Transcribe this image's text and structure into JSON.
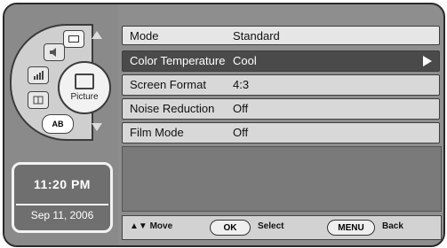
{
  "menu": {
    "header": {
      "label": "Mode",
      "value": "Standard"
    },
    "items": [
      {
        "label": "Color Temperature",
        "value": "Cool",
        "selected": true
      },
      {
        "label": "Screen Format",
        "value": "4:3",
        "selected": false
      },
      {
        "label": "Noise Reduction",
        "value": "Off",
        "selected": false
      },
      {
        "label": "Film Mode",
        "value": "Off",
        "selected": false
      }
    ]
  },
  "wheel": {
    "center_label": "Picture",
    "bottom_button": "AB",
    "icons": [
      "screen-icon",
      "speaker-icon",
      "signal-icon",
      "channel-icon",
      "picture-icon"
    ]
  },
  "clock": {
    "time": "11:20 PM",
    "date": "Sep 11, 2006"
  },
  "footer": {
    "move_label": "▲▼ Move",
    "ok_key": "OK",
    "select_label": "Select",
    "menu_key": "MENU",
    "back_label": "Back"
  },
  "colors": {
    "selected_row": "#4a4a4a",
    "row": "#d8d8d8",
    "frame": "#8e8e8e"
  }
}
